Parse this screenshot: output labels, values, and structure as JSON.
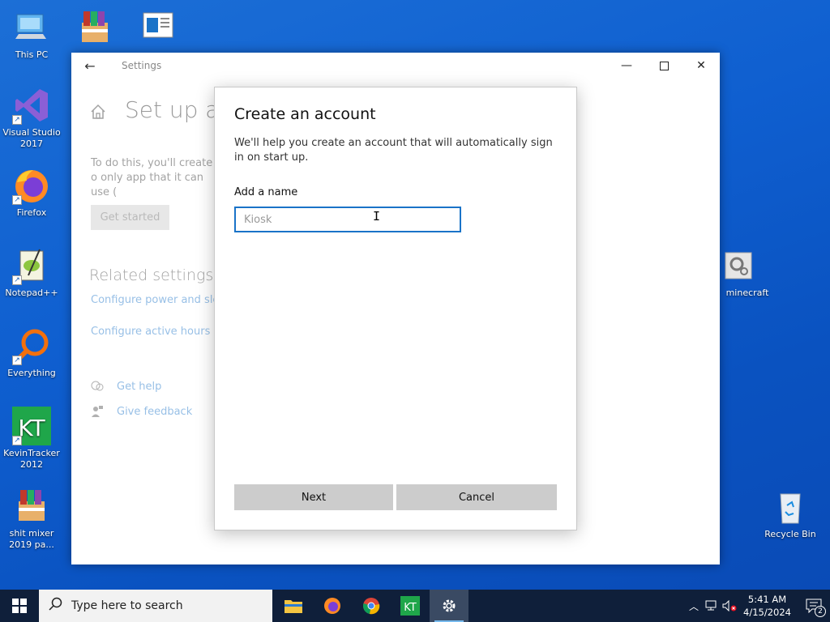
{
  "desktop": {
    "icons": [
      {
        "label": "This PC"
      },
      {
        "label": ""
      },
      {
        "label": ""
      },
      {
        "label": "Visual Studio 2017"
      },
      {
        "label": "Firefox"
      },
      {
        "label": "Notepad++"
      },
      {
        "label": "Everything"
      },
      {
        "label": "KevinTracker 2012"
      },
      {
        "label": "shit mixer 2019 pa..."
      },
      {
        "label": "minecraft"
      },
      {
        "label": "Recycle Bin"
      }
    ]
  },
  "window": {
    "title": "Settings",
    "page_title": "Set up a k",
    "description": "To do this, you'll create o only app that it can use (",
    "get_started_label": "Get started",
    "related_title": "Related settings",
    "related_links": [
      "Configure power and sle",
      "Configure active hours"
    ],
    "get_help_label": "Get help",
    "give_feedback_label": "Give feedback"
  },
  "dialog": {
    "title": "Create an account",
    "description": "We'll help you create an account that will automatically sign in on start up.",
    "name_label": "Add a name",
    "name_placeholder": "Kiosk",
    "next_label": "Next",
    "cancel_label": "Cancel"
  },
  "taskbar": {
    "search_placeholder": "Type here to search",
    "time": "5:41 AM",
    "date": "4/15/2024",
    "notification_count": "2"
  },
  "colors": {
    "accent": "#1a73c8",
    "desktop_blue": "#0f5fd0",
    "taskbar": "#0f1f3a"
  }
}
